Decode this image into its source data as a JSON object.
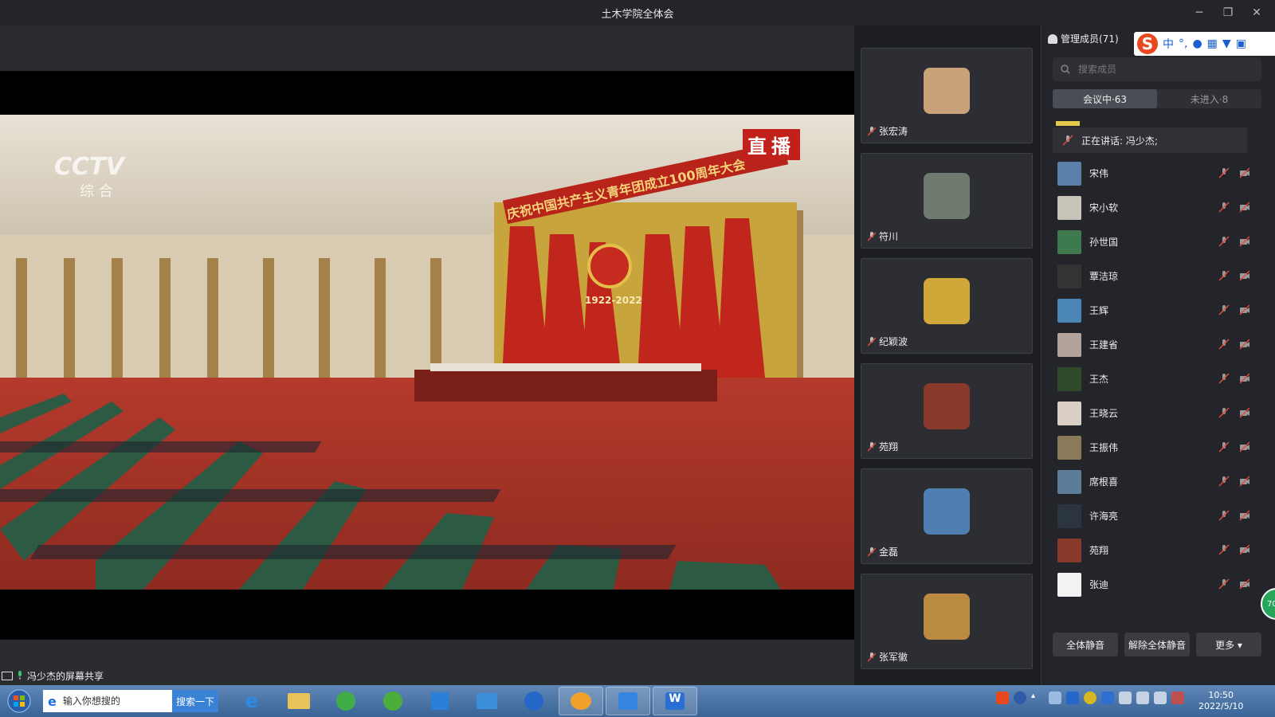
{
  "window": {
    "title": "土木学院全体会",
    "controls": [
      "minimize-icon",
      "restore-icon",
      "close-icon"
    ]
  },
  "main": {
    "live_badge": "直播",
    "channel_logo": "CCTV",
    "channel_sub": "综 合",
    "banner_text": "庆祝中国共产主义青年团成立100周年大会",
    "emblem_years": "1922-2022",
    "screen_share_label": "冯少杰的屏幕共享"
  },
  "video_tiles": [
    {
      "name": "张宏涛",
      "avatar_color": "#c9a27a"
    },
    {
      "name": "符川",
      "avatar_color": "#6f7a6e"
    },
    {
      "name": "纪颖波",
      "avatar_color": "#d0a83a"
    },
    {
      "name": "苑翔",
      "avatar_color": "#8a3a2a"
    },
    {
      "name": "金磊",
      "avatar_color": "#4f7fb0"
    },
    {
      "name": "张军徽",
      "avatar_color": "#b98a40"
    }
  ],
  "members_panel": {
    "title": "管理成员(71)",
    "search_placeholder": "搜索成员",
    "tabs": [
      {
        "label": "会议中·63",
        "active": true
      },
      {
        "label": "未进入·8",
        "active": false
      }
    ],
    "speaking_now": "正在讲话: 冯少杰;",
    "members": [
      {
        "name": "宋伟",
        "avatar_color": "#5a7fa8"
      },
      {
        "name": "宋小软",
        "avatar_color": "#c8c3b8"
      },
      {
        "name": "孙世国",
        "avatar_color": "#3f7a4e"
      },
      {
        "name": "覃洁琼",
        "avatar_color": "#333333"
      },
      {
        "name": "王辉",
        "avatar_color": "#4a85b5"
      },
      {
        "name": "王建省",
        "avatar_color": "#b3a39a"
      },
      {
        "name": "王杰",
        "avatar_color": "#2f4a2a"
      },
      {
        "name": "王晓云",
        "avatar_color": "#d9cfc4"
      },
      {
        "name": "王振伟",
        "avatar_color": "#8a7a5a"
      },
      {
        "name": "席根喜",
        "avatar_color": "#5b7d9a"
      },
      {
        "name": "许海亮",
        "avatar_color": "#2a3540"
      },
      {
        "name": "苑翔",
        "avatar_color": "#8a3a2a"
      },
      {
        "name": "张迪",
        "avatar_color": "#f2f2f2"
      }
    ],
    "buttons": {
      "mute_all": "全体静音",
      "unmute_all": "解除全体静音",
      "more": "更多 ▾"
    }
  },
  "ime_toolbar": {
    "logo": "S",
    "mode": "中",
    "items": [
      "°,",
      "mic-icon",
      "keyboard-icon",
      "shirt-icon",
      "grid-icon"
    ]
  },
  "taskbar": {
    "search_placeholder": "输入你想搜的",
    "search_button": "搜索一下",
    "apps": [
      "ie-icon",
      "folder-icon",
      "refresh-app-icon",
      "wifi-app-icon",
      "grid-app-icon",
      "calendar-app-icon",
      "feather-app-icon",
      "meeting-app-icon",
      "chart-app-icon",
      "wps-icon"
    ],
    "active_app": "meeting-app-icon",
    "clock_time": "10:50",
    "clock_date": "2022/5/10"
  },
  "floating_badge": "70"
}
